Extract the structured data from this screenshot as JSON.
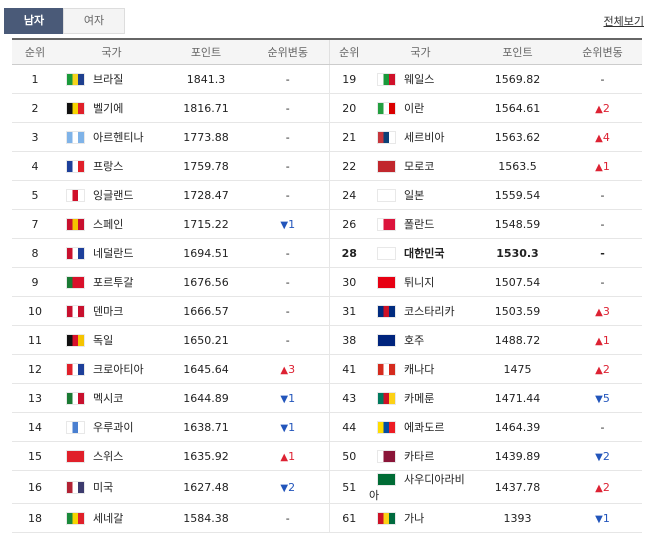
{
  "tabs": {
    "male": "남자",
    "female": "여자"
  },
  "view_all": "전체보기",
  "headers": [
    "순위",
    "국가",
    "포인트",
    "순위변동",
    "순위",
    "국가",
    "포인트",
    "순위변동"
  ],
  "left": [
    {
      "rank": "1",
      "country": "브라질",
      "points": "1841.3",
      "change": "-",
      "dir": "none",
      "flag": "brazil-flag-icon",
      "colors": [
        "#1a9a3b",
        "#f6d31c",
        "#1e3f8f"
      ]
    },
    {
      "rank": "2",
      "country": "벨기에",
      "points": "1816.71",
      "change": "-",
      "dir": "none",
      "flag": "belgium-flag-icon",
      "colors": [
        "#111",
        "#f5d400",
        "#e0202a"
      ]
    },
    {
      "rank": "3",
      "country": "아르헨티나",
      "points": "1773.88",
      "change": "-",
      "dir": "none",
      "flag": "argentina-flag-icon",
      "colors": [
        "#7fb3e8",
        "#ffffff",
        "#7fb3e8"
      ]
    },
    {
      "rank": "4",
      "country": "프랑스",
      "points": "1759.78",
      "change": "-",
      "dir": "none",
      "flag": "france-flag-icon",
      "colors": [
        "#1d3f9a",
        "#ffffff",
        "#e0202a"
      ]
    },
    {
      "rank": "5",
      "country": "잉글랜드",
      "points": "1728.47",
      "change": "-",
      "dir": "none",
      "flag": "england-flag-icon",
      "colors": [
        "#ffffff",
        "#d0102a",
        "#ffffff"
      ]
    },
    {
      "rank": "7",
      "country": "스페인",
      "points": "1715.22",
      "change": "1",
      "dir": "down",
      "flag": "spain-flag-icon",
      "colors": [
        "#c8102e",
        "#f5c400",
        "#c8102e"
      ]
    },
    {
      "rank": "8",
      "country": "네덜란드",
      "points": "1694.51",
      "change": "-",
      "dir": "none",
      "flag": "netherlands-flag-icon",
      "colors": [
        "#c8102e",
        "#ffffff",
        "#1d3f9a"
      ]
    },
    {
      "rank": "9",
      "country": "포르투갈",
      "points": "1676.56",
      "change": "-",
      "dir": "none",
      "flag": "portugal-flag-icon",
      "colors": [
        "#1a7a33",
        "#d8102a",
        "#d8102a"
      ]
    },
    {
      "rank": "10",
      "country": "덴마크",
      "points": "1666.57",
      "change": "-",
      "dir": "none",
      "flag": "denmark-flag-icon",
      "colors": [
        "#c8102e",
        "#ffffff",
        "#c8102e"
      ]
    },
    {
      "rank": "11",
      "country": "독일",
      "points": "1650.21",
      "change": "-",
      "dir": "none",
      "flag": "germany-flag-icon",
      "colors": [
        "#111",
        "#d8102a",
        "#f5c400"
      ]
    },
    {
      "rank": "12",
      "country": "크로아티아",
      "points": "1645.64",
      "change": "3",
      "dir": "up",
      "flag": "croatia-flag-icon",
      "colors": [
        "#e0202a",
        "#ffffff",
        "#1d3f9a"
      ]
    },
    {
      "rank": "13",
      "country": "멕시코",
      "points": "1644.89",
      "change": "1",
      "dir": "down",
      "flag": "mexico-flag-icon",
      "colors": [
        "#1a7a33",
        "#ffffff",
        "#c8102e"
      ]
    },
    {
      "rank": "14",
      "country": "우루과이",
      "points": "1638.71",
      "change": "1",
      "dir": "down",
      "flag": "uruguay-flag-icon",
      "colors": [
        "#ffffff",
        "#4a7fd0",
        "#ffffff"
      ]
    },
    {
      "rank": "15",
      "country": "스위스",
      "points": "1635.92",
      "change": "1",
      "dir": "up",
      "flag": "switzerland-flag-icon",
      "colors": [
        "#e0202a",
        "#e0202a",
        "#e0202a"
      ]
    },
    {
      "rank": "16",
      "country": "미국",
      "points": "1627.48",
      "change": "2",
      "dir": "down",
      "flag": "usa-flag-icon",
      "colors": [
        "#b22234",
        "#ffffff",
        "#3c3b6e"
      ]
    },
    {
      "rank": "18",
      "country": "세네갈",
      "points": "1584.38",
      "change": "-",
      "dir": "none",
      "flag": "senegal-flag-icon",
      "colors": [
        "#1a8a3b",
        "#f5d400",
        "#e0202a"
      ]
    }
  ],
  "right": [
    {
      "rank": "19",
      "country": "웨일스",
      "points": "1569.82",
      "change": "-",
      "dir": "none",
      "flag": "wales-flag-icon",
      "colors": [
        "#ffffff",
        "#1a9a3b",
        "#d0102a"
      ]
    },
    {
      "rank": "20",
      "country": "이란",
      "points": "1564.61",
      "change": "2",
      "dir": "up",
      "flag": "iran-flag-icon",
      "colors": [
        "#239f40",
        "#ffffff",
        "#da0000"
      ]
    },
    {
      "rank": "21",
      "country": "세르비아",
      "points": "1563.62",
      "change": "4",
      "dir": "up",
      "flag": "serbia-flag-icon",
      "colors": [
        "#c6363c",
        "#0c4076",
        "#ffffff"
      ]
    },
    {
      "rank": "22",
      "country": "모로코",
      "points": "1563.5",
      "change": "1",
      "dir": "up",
      "flag": "morocco-flag-icon",
      "colors": [
        "#c1272d",
        "#c1272d",
        "#c1272d"
      ]
    },
    {
      "rank": "24",
      "country": "일본",
      "points": "1559.54",
      "change": "-",
      "dir": "none",
      "flag": "japan-flag-icon",
      "colors": [
        "#ffffff",
        "#ffffff",
        "#ffffff"
      ]
    },
    {
      "rank": "26",
      "country": "폴란드",
      "points": "1548.59",
      "change": "-",
      "dir": "none",
      "flag": "poland-flag-icon",
      "colors": [
        "#ffffff",
        "#dc143c",
        "#dc143c"
      ]
    },
    {
      "rank": "28",
      "country": "대한민국",
      "points": "1530.3",
      "change": "-",
      "dir": "none",
      "flag": "korea-flag-icon",
      "colors": [
        "#ffffff",
        "#ffffff",
        "#ffffff"
      ],
      "highlight": true
    },
    {
      "rank": "30",
      "country": "튀니지",
      "points": "1507.54",
      "change": "-",
      "dir": "none",
      "flag": "tunisia-flag-icon",
      "colors": [
        "#e70013",
        "#e70013",
        "#e70013"
      ]
    },
    {
      "rank": "31",
      "country": "코스타리카",
      "points": "1503.59",
      "change": "3",
      "dir": "up",
      "flag": "costa-rica-flag-icon",
      "colors": [
        "#002b7f",
        "#ce1126",
        "#002b7f"
      ]
    },
    {
      "rank": "38",
      "country": "호주",
      "points": "1488.72",
      "change": "1",
      "dir": "up",
      "flag": "australia-flag-icon",
      "colors": [
        "#00247d",
        "#00247d",
        "#00247d"
      ]
    },
    {
      "rank": "41",
      "country": "캐나다",
      "points": "1475",
      "change": "2",
      "dir": "up",
      "flag": "canada-flag-icon",
      "colors": [
        "#d52b1e",
        "#ffffff",
        "#d52b1e"
      ]
    },
    {
      "rank": "43",
      "country": "카메룬",
      "points": "1471.44",
      "change": "5",
      "dir": "down",
      "flag": "cameroon-flag-icon",
      "colors": [
        "#007a5e",
        "#ce1126",
        "#fcd116"
      ]
    },
    {
      "rank": "44",
      "country": "에콰도르",
      "points": "1464.39",
      "change": "-",
      "dir": "none",
      "flag": "ecuador-flag-icon",
      "colors": [
        "#ffdd00",
        "#034ea2",
        "#ed1c24"
      ]
    },
    {
      "rank": "50",
      "country": "카타르",
      "points": "1439.89",
      "change": "2",
      "dir": "down",
      "flag": "qatar-flag-icon",
      "colors": [
        "#ffffff",
        "#8a1538",
        "#8a1538"
      ]
    },
    {
      "rank": "51",
      "country": "사우디아라비아",
      "points": "1437.78",
      "change": "2",
      "dir": "up",
      "flag": "saudi-arabia-flag-icon",
      "colors": [
        "#006c35",
        "#006c35",
        "#006c35"
      ]
    },
    {
      "rank": "61",
      "country": "가나",
      "points": "1393",
      "change": "1",
      "dir": "down",
      "flag": "ghana-flag-icon",
      "colors": [
        "#ce1126",
        "#fcd116",
        "#006b3f"
      ]
    }
  ]
}
